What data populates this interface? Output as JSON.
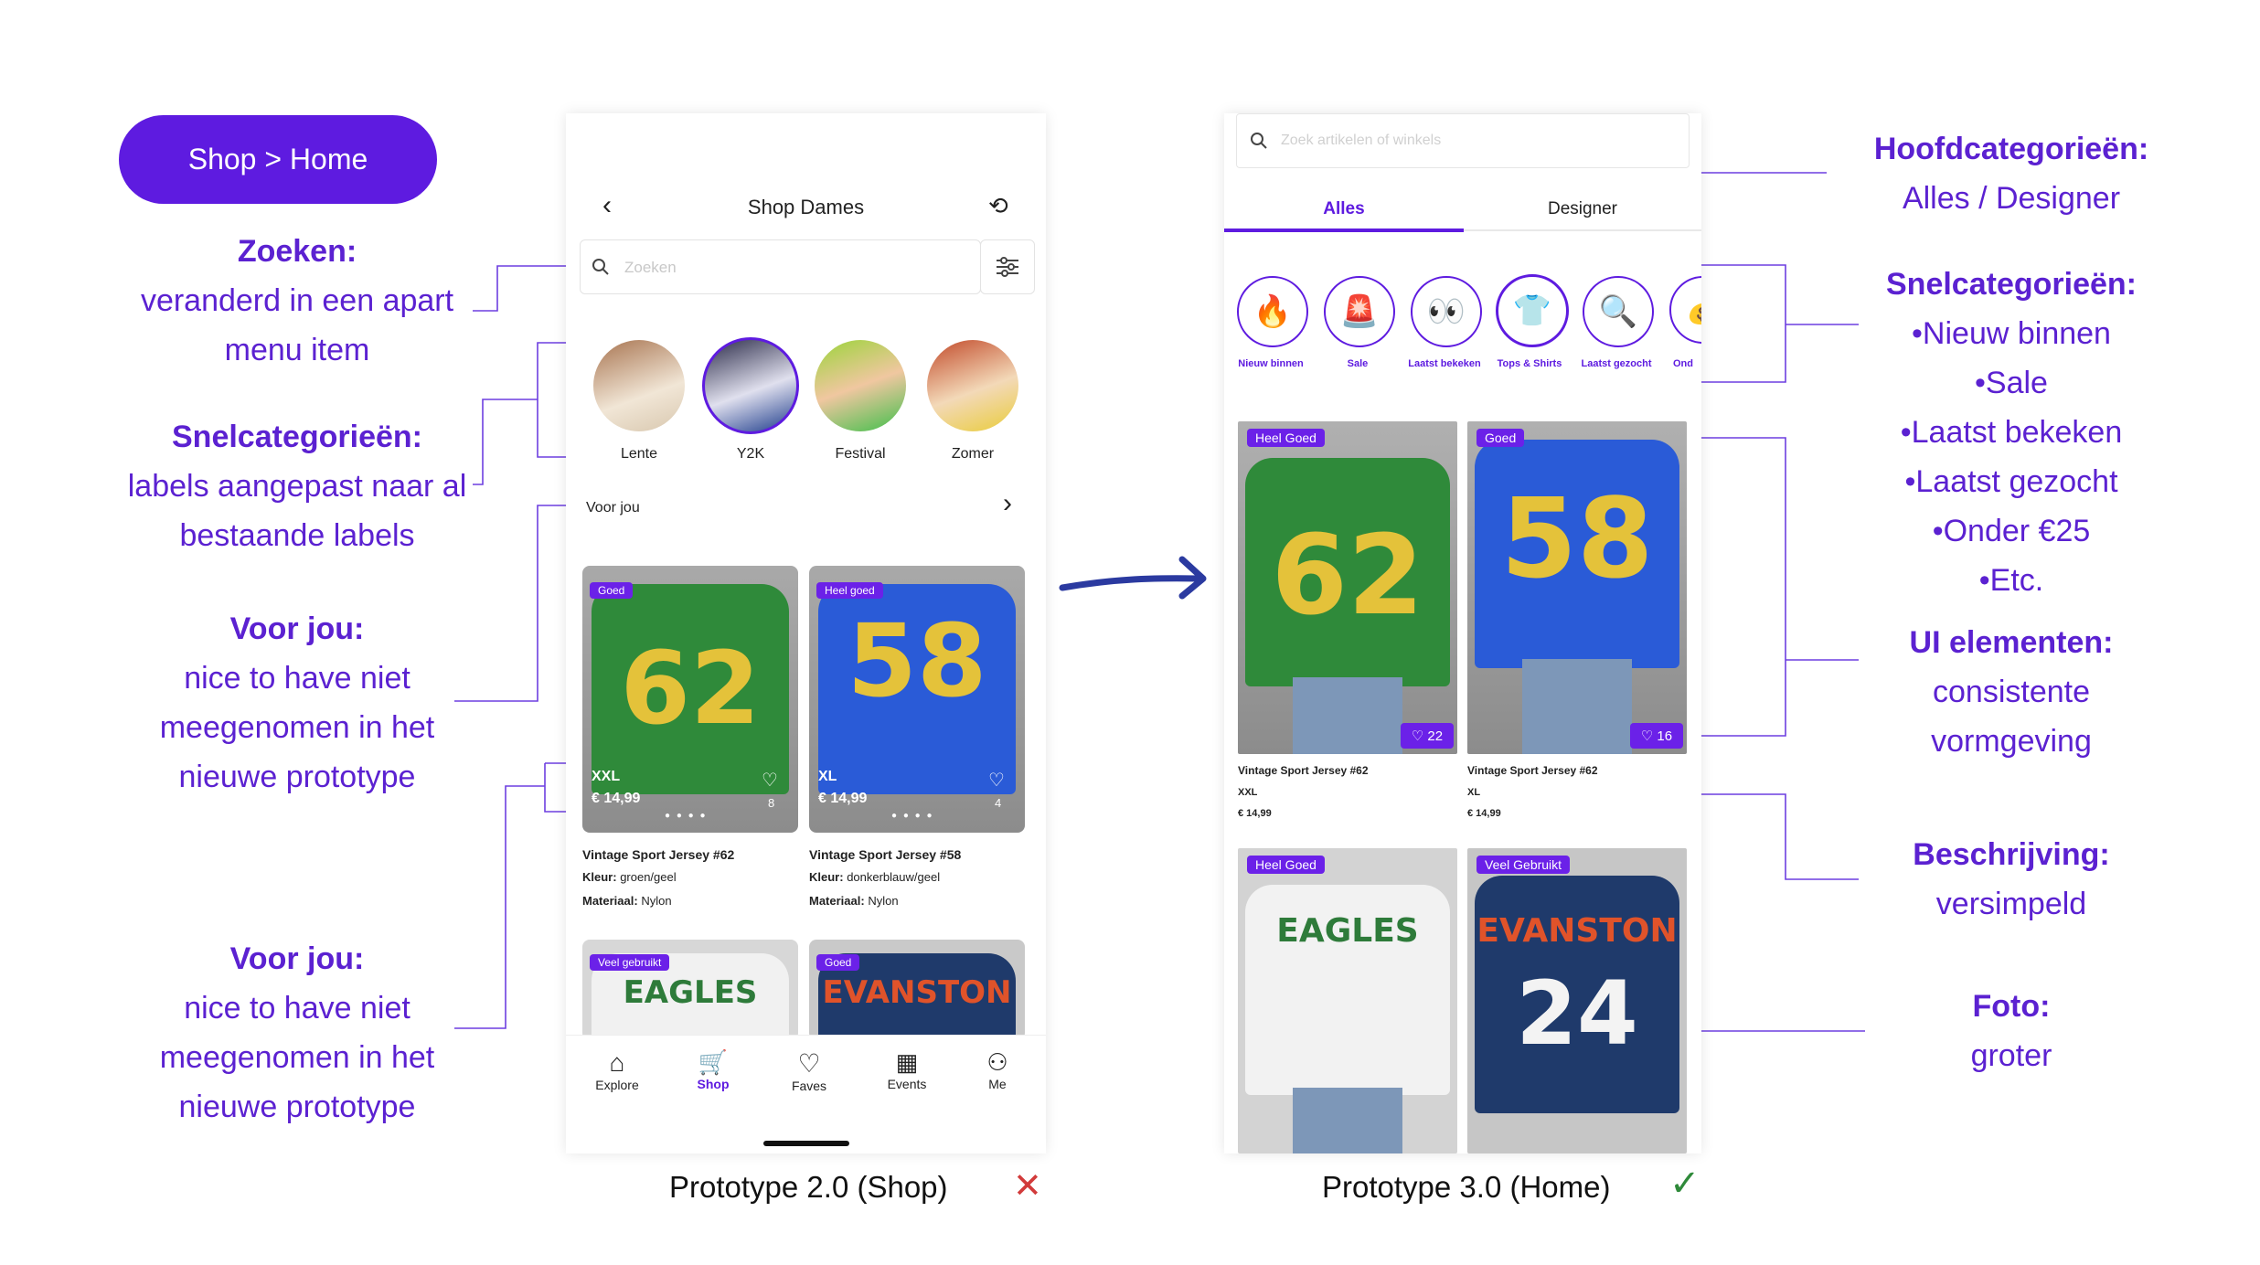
{
  "header": {
    "pill": "Shop > Home"
  },
  "left_notes": {
    "zoeken": {
      "title": "Zoeken:",
      "l1": "veranderd in een apart",
      "l2": "menu item"
    },
    "snel": {
      "title": "Snelcategorieën:",
      "l1": "labels aangepast naar al",
      "l2": "bestaande labels"
    },
    "voorjou1": {
      "title": "Voor jou:",
      "l1": "nice to have niet",
      "l2": "meegenomen in het",
      "l3": "nieuwe prototype"
    },
    "voorjou2": {
      "title": "Voor jou:",
      "l1": "nice to have niet",
      "l2": "meegenomen in het",
      "l3": "nieuwe prototype"
    }
  },
  "right_notes": {
    "hoofd": {
      "title": "Hoofdcategorieën:",
      "l1": "Alles / Designer"
    },
    "snel": {
      "title": "Snelcategorieën:",
      "l1": "•Nieuw binnen",
      "l2": "•Sale",
      "l3": "•Laatst bekeken",
      "l4": "•Laatst gezocht",
      "l5": "•Onder €25",
      "l6": "•Etc."
    },
    "ui": {
      "title": "UI elementen:",
      "l1": "consistente",
      "l2": "vormgeving"
    },
    "beschrijving": {
      "title": "Beschrijving:",
      "l1": "versimpeld"
    },
    "foto": {
      "title": "Foto:",
      "l1": "groter"
    }
  },
  "proto2": {
    "title": "Shop Dames",
    "search_placeholder": "Zoeken",
    "stories": [
      "Lente",
      "Y2K",
      "Festival",
      "Zomer"
    ],
    "section": "Voor jou",
    "products": [
      {
        "badge": "Goed",
        "size": "XXL",
        "price": "€ 14,99",
        "likes": "8",
        "name": "Vintage Sport Jersey #62",
        "kleur_label": "Kleur:",
        "kleur": "groen/geel",
        "mat_label": "Materiaal:",
        "mat": "Nylon",
        "number": "62"
      },
      {
        "badge": "Heel goed",
        "size": "XL",
        "price": "€ 14,99",
        "likes": "4",
        "name": "Vintage Sport Jersey #58",
        "kleur_label": "Kleur:",
        "kleur": "donkerblauw/geel",
        "mat_label": "Materiaal:",
        "mat": "Nylon",
        "number": "58"
      }
    ],
    "more": [
      {
        "badge": "Veel gebruikt",
        "text": "EAGLES"
      },
      {
        "badge": "Goed",
        "text": "EVANSTON"
      }
    ],
    "nav": [
      "Explore",
      "Shop",
      "Faves",
      "Events",
      "Me"
    ],
    "caption": "Prototype 2.0 (Shop)",
    "mark": "✕"
  },
  "proto3": {
    "search_placeholder": "Zoek artikelen of winkels",
    "tabs": [
      "Alles",
      "Designer"
    ],
    "cats": [
      {
        "label": "Nieuw binnen",
        "icon": "🔥"
      },
      {
        "label": "Sale",
        "icon": "🚨"
      },
      {
        "label": "Laatst bekeken",
        "icon": "👀"
      },
      {
        "label": "Tops & Shirts",
        "icon": "👕"
      },
      {
        "label": "Laatst gezocht",
        "icon": "🔍"
      },
      {
        "label": "Ond",
        "icon": "💰"
      }
    ],
    "products": [
      {
        "badge": "Heel Goed",
        "likes": "22",
        "name": "Vintage Sport Jersey #62",
        "size": "XXL",
        "price": "€ 14,99",
        "number": "62"
      },
      {
        "badge": "Goed",
        "likes": "16",
        "name": "Vintage Sport Jersey #62",
        "size": "XL",
        "price": "€ 14,99",
        "number": "58"
      },
      {
        "badge": "Heel Goed",
        "text": "EAGLES"
      },
      {
        "badge": "Veel Gebruikt",
        "text": "EVANSTON",
        "number": "24"
      }
    ],
    "caption": "Prototype 3.0 (Home)",
    "mark": "✓"
  },
  "colors": {
    "accent": "#5e1be0",
    "text_purple": "#5b21d1",
    "green": "#2f8a3a",
    "blue": "#2a5bd7",
    "red": "#d23b3b"
  }
}
